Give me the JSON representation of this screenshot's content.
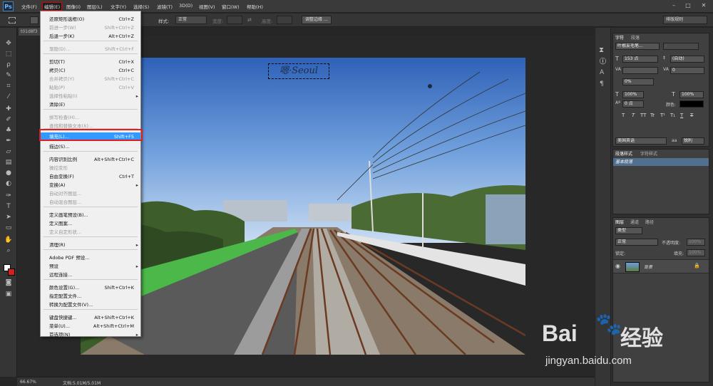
{
  "app": {
    "logo": "Ps"
  },
  "menubar": {
    "items": [
      "文件(F)",
      "编辑(E)",
      "图像(I)",
      "图层(L)",
      "文字(Y)",
      "选择(S)",
      "滤镜(T)",
      "3D(D)",
      "视图(V)",
      "窗口(W)",
      "帮助(H)"
    ],
    "window_controls": [
      "–",
      "□",
      "✕"
    ]
  },
  "options": {
    "style_label": "样式:",
    "style_value": "正常",
    "width_label": "宽度:",
    "height_label": "高度:",
    "refine_button": "调整边缘 ...",
    "workspace": "排版规则"
  },
  "document": {
    "tab": "t01d8f3",
    "watermark_text": "嗯·Seoul"
  },
  "status": {
    "zoom": "66.67%",
    "doc_size": "文档:5.01M/5.01M"
  },
  "edit_menu": {
    "items": [
      {
        "label": "还原矩形选框(O)",
        "shortcut": "Ctrl+Z",
        "disabled": false
      },
      {
        "label": "前进一步(W)",
        "shortcut": "Shift+Ctrl+Z",
        "disabled": true
      },
      {
        "label": "后退一步(K)",
        "shortcut": "Alt+Ctrl+Z",
        "disabled": false
      },
      {
        "label": "渐隐(D)...",
        "shortcut": "Shift+Ctrl+F",
        "disabled": true
      },
      {
        "label": "剪切(T)",
        "shortcut": "Ctrl+X",
        "disabled": false
      },
      {
        "label": "拷贝(C)",
        "shortcut": "Ctrl+C",
        "disabled": false
      },
      {
        "label": "合并拷贝(Y)",
        "shortcut": "Shift+Ctrl+C",
        "disabled": true
      },
      {
        "label": "粘贴(P)",
        "shortcut": "Ctrl+V",
        "disabled": true
      },
      {
        "label": "选择性粘贴(I)",
        "shortcut": "",
        "disabled": true,
        "submenu": true
      },
      {
        "label": "清除(E)",
        "shortcut": "",
        "disabled": false
      },
      {
        "label": "拼写检查(H)...",
        "shortcut": "",
        "disabled": true
      },
      {
        "label": "查找和替换文本(X)...",
        "shortcut": "",
        "disabled": true
      },
      {
        "label": "填充(L)...",
        "shortcut": "Shift+F5",
        "disabled": false,
        "highlighted": true
      },
      {
        "label": "描边(S)...",
        "shortcut": "",
        "disabled": false
      },
      {
        "label": "内容识别比例",
        "shortcut": "Alt+Shift+Ctrl+C",
        "disabled": false
      },
      {
        "label": "操控变形",
        "shortcut": "",
        "disabled": true
      },
      {
        "label": "自由变换(F)",
        "shortcut": "Ctrl+T",
        "disabled": false
      },
      {
        "label": "变换(A)",
        "shortcut": "",
        "disabled": false,
        "submenu": true
      },
      {
        "label": "自动对齐图层...",
        "shortcut": "",
        "disabled": true
      },
      {
        "label": "自动混合图层...",
        "shortcut": "",
        "disabled": true
      },
      {
        "label": "定义画笔预设(B)...",
        "shortcut": "",
        "disabled": false
      },
      {
        "label": "定义图案...",
        "shortcut": "",
        "disabled": false
      },
      {
        "label": "定义自定形状...",
        "shortcut": "",
        "disabled": true
      },
      {
        "label": "清理(R)",
        "shortcut": "",
        "disabled": false,
        "submenu": true
      },
      {
        "label": "Adobe PDF 预设...",
        "shortcut": "",
        "disabled": false
      },
      {
        "label": "预设",
        "shortcut": "",
        "disabled": false,
        "submenu": true
      },
      {
        "label": "远程连接...",
        "shortcut": "",
        "disabled": false
      },
      {
        "label": "颜色设置(G)...",
        "shortcut": "Shift+Ctrl+K",
        "disabled": false
      },
      {
        "label": "指定配置文件...",
        "shortcut": "",
        "disabled": false
      },
      {
        "label": "转换为配置文件(V)...",
        "shortcut": "",
        "disabled": false
      },
      {
        "label": "键盘快捷键...",
        "shortcut": "Alt+Shift+Ctrl+K",
        "disabled": false
      },
      {
        "label": "菜单(U)...",
        "shortcut": "Alt+Shift+Ctrl+M",
        "disabled": false
      },
      {
        "label": "首选项(N)",
        "shortcut": "",
        "disabled": false,
        "submenu": true
      }
    ]
  },
  "char_panel": {
    "tabs": [
      "字符",
      "段落"
    ],
    "font_family": "叶根友毛笔...",
    "font_style": "-",
    "font_size": "153 点",
    "leading": "(自动)",
    "kerning": "",
    "tracking": "0",
    "scale_percent": "0%",
    "vscale": "100%",
    "hscale": "100%",
    "baseline": "0 点",
    "color_label": "颜色:",
    "style_buttons": [
      "T",
      "T",
      "TT",
      "Tr",
      "T¹",
      "T₁",
      "T",
      "T"
    ],
    "language": "美国英语",
    "aa_label": "aa",
    "aa_value": "锐利"
  },
  "para_style_panel": {
    "tabs": [
      "段落样式",
      "字符样式"
    ],
    "item": "基本段落"
  },
  "layers_panel": {
    "tabs": [
      "图层",
      "通道",
      "路径"
    ],
    "filter": "类型",
    "blend": "正常",
    "opacity_label": "不透明度:",
    "opacity": "100%",
    "lock_label": "锁定:",
    "fill_label": "填充:",
    "fill": "100%",
    "layer_name": "背景"
  },
  "watermark": {
    "brand": "Bai",
    "brand2": "经验",
    "url": "jingyan.baidu.com"
  },
  "colors": {
    "highlight": "#3399ff",
    "accent_red": "#e02020"
  }
}
